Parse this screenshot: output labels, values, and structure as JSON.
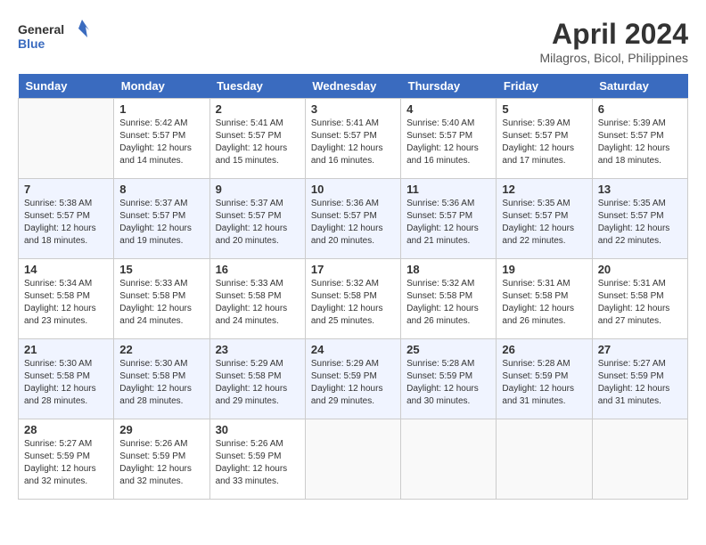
{
  "header": {
    "logo_line1": "General",
    "logo_line2": "Blue",
    "month_year": "April 2024",
    "location": "Milagros, Bicol, Philippines"
  },
  "weekdays": [
    "Sunday",
    "Monday",
    "Tuesday",
    "Wednesday",
    "Thursday",
    "Friday",
    "Saturday"
  ],
  "weeks": [
    [
      {
        "day": "",
        "info": ""
      },
      {
        "day": "1",
        "info": "Sunrise: 5:42 AM\nSunset: 5:57 PM\nDaylight: 12 hours\nand 14 minutes."
      },
      {
        "day": "2",
        "info": "Sunrise: 5:41 AM\nSunset: 5:57 PM\nDaylight: 12 hours\nand 15 minutes."
      },
      {
        "day": "3",
        "info": "Sunrise: 5:41 AM\nSunset: 5:57 PM\nDaylight: 12 hours\nand 16 minutes."
      },
      {
        "day": "4",
        "info": "Sunrise: 5:40 AM\nSunset: 5:57 PM\nDaylight: 12 hours\nand 16 minutes."
      },
      {
        "day": "5",
        "info": "Sunrise: 5:39 AM\nSunset: 5:57 PM\nDaylight: 12 hours\nand 17 minutes."
      },
      {
        "day": "6",
        "info": "Sunrise: 5:39 AM\nSunset: 5:57 PM\nDaylight: 12 hours\nand 18 minutes."
      }
    ],
    [
      {
        "day": "7",
        "info": "Sunrise: 5:38 AM\nSunset: 5:57 PM\nDaylight: 12 hours\nand 18 minutes."
      },
      {
        "day": "8",
        "info": "Sunrise: 5:37 AM\nSunset: 5:57 PM\nDaylight: 12 hours\nand 19 minutes."
      },
      {
        "day": "9",
        "info": "Sunrise: 5:37 AM\nSunset: 5:57 PM\nDaylight: 12 hours\nand 20 minutes."
      },
      {
        "day": "10",
        "info": "Sunrise: 5:36 AM\nSunset: 5:57 PM\nDaylight: 12 hours\nand 20 minutes."
      },
      {
        "day": "11",
        "info": "Sunrise: 5:36 AM\nSunset: 5:57 PM\nDaylight: 12 hours\nand 21 minutes."
      },
      {
        "day": "12",
        "info": "Sunrise: 5:35 AM\nSunset: 5:57 PM\nDaylight: 12 hours\nand 22 minutes."
      },
      {
        "day": "13",
        "info": "Sunrise: 5:35 AM\nSunset: 5:57 PM\nDaylight: 12 hours\nand 22 minutes."
      }
    ],
    [
      {
        "day": "14",
        "info": "Sunrise: 5:34 AM\nSunset: 5:58 PM\nDaylight: 12 hours\nand 23 minutes."
      },
      {
        "day": "15",
        "info": "Sunrise: 5:33 AM\nSunset: 5:58 PM\nDaylight: 12 hours\nand 24 minutes."
      },
      {
        "day": "16",
        "info": "Sunrise: 5:33 AM\nSunset: 5:58 PM\nDaylight: 12 hours\nand 24 minutes."
      },
      {
        "day": "17",
        "info": "Sunrise: 5:32 AM\nSunset: 5:58 PM\nDaylight: 12 hours\nand 25 minutes."
      },
      {
        "day": "18",
        "info": "Sunrise: 5:32 AM\nSunset: 5:58 PM\nDaylight: 12 hours\nand 26 minutes."
      },
      {
        "day": "19",
        "info": "Sunrise: 5:31 AM\nSunset: 5:58 PM\nDaylight: 12 hours\nand 26 minutes."
      },
      {
        "day": "20",
        "info": "Sunrise: 5:31 AM\nSunset: 5:58 PM\nDaylight: 12 hours\nand 27 minutes."
      }
    ],
    [
      {
        "day": "21",
        "info": "Sunrise: 5:30 AM\nSunset: 5:58 PM\nDaylight: 12 hours\nand 28 minutes."
      },
      {
        "day": "22",
        "info": "Sunrise: 5:30 AM\nSunset: 5:58 PM\nDaylight: 12 hours\nand 28 minutes."
      },
      {
        "day": "23",
        "info": "Sunrise: 5:29 AM\nSunset: 5:58 PM\nDaylight: 12 hours\nand 29 minutes."
      },
      {
        "day": "24",
        "info": "Sunrise: 5:29 AM\nSunset: 5:59 PM\nDaylight: 12 hours\nand 29 minutes."
      },
      {
        "day": "25",
        "info": "Sunrise: 5:28 AM\nSunset: 5:59 PM\nDaylight: 12 hours\nand 30 minutes."
      },
      {
        "day": "26",
        "info": "Sunrise: 5:28 AM\nSunset: 5:59 PM\nDaylight: 12 hours\nand 31 minutes."
      },
      {
        "day": "27",
        "info": "Sunrise: 5:27 AM\nSunset: 5:59 PM\nDaylight: 12 hours\nand 31 minutes."
      }
    ],
    [
      {
        "day": "28",
        "info": "Sunrise: 5:27 AM\nSunset: 5:59 PM\nDaylight: 12 hours\nand 32 minutes."
      },
      {
        "day": "29",
        "info": "Sunrise: 5:26 AM\nSunset: 5:59 PM\nDaylight: 12 hours\nand 32 minutes."
      },
      {
        "day": "30",
        "info": "Sunrise: 5:26 AM\nSunset: 5:59 PM\nDaylight: 12 hours\nand 33 minutes."
      },
      {
        "day": "",
        "info": ""
      },
      {
        "day": "",
        "info": ""
      },
      {
        "day": "",
        "info": ""
      },
      {
        "day": "",
        "info": ""
      }
    ]
  ]
}
